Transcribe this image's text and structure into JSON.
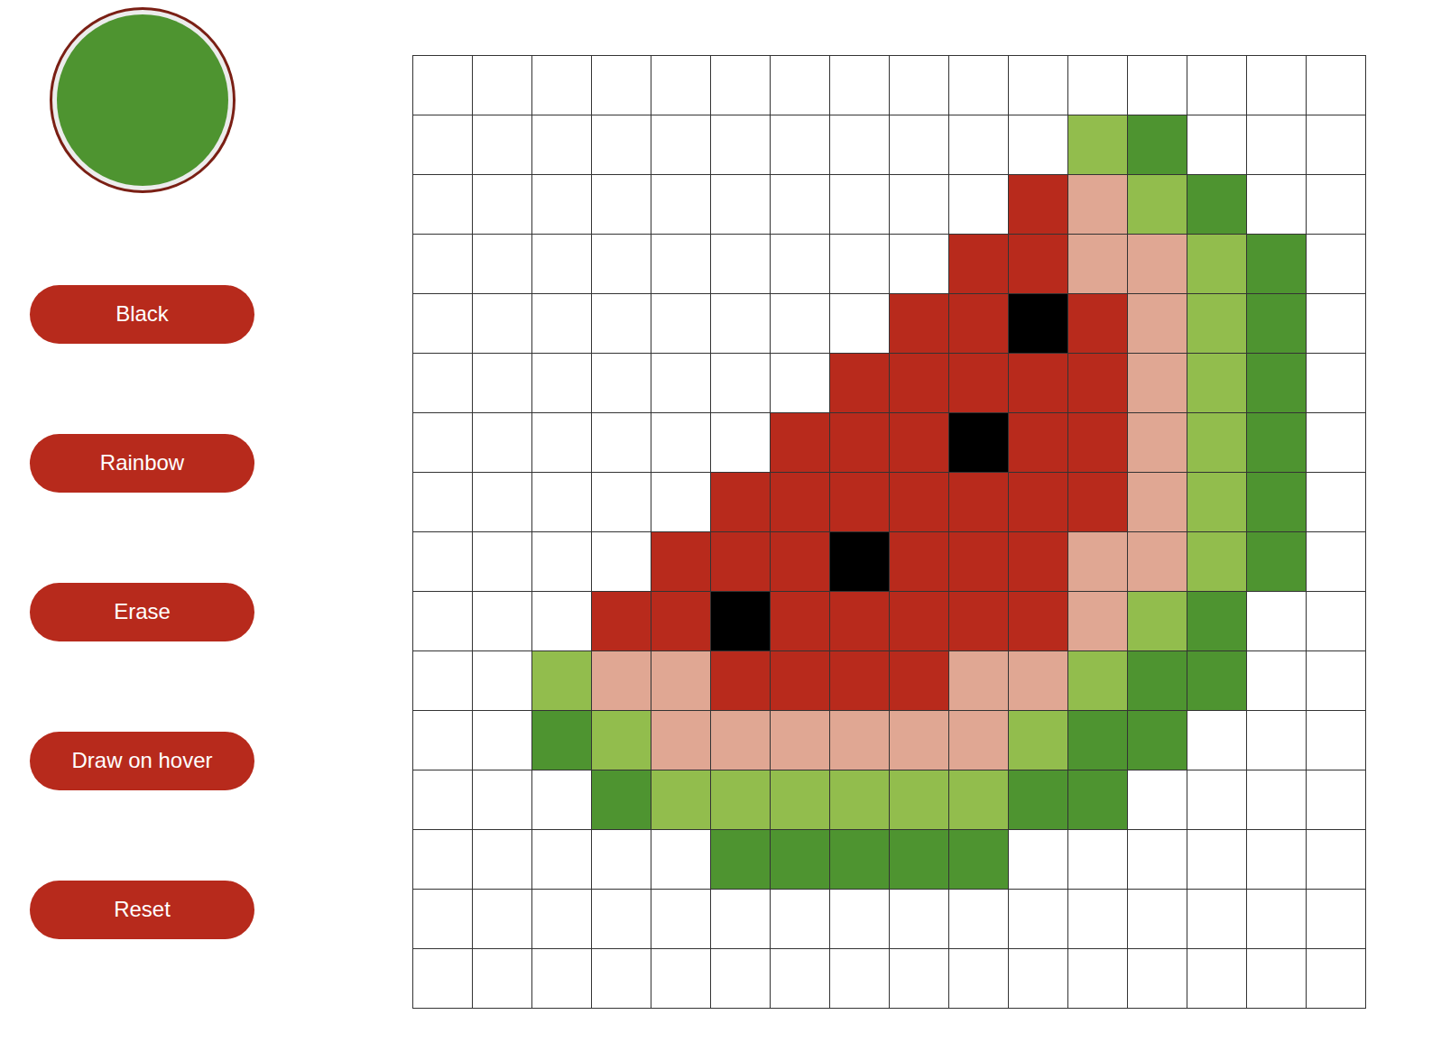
{
  "current_color": "#4e9430",
  "buttons": [
    "Black",
    "Rainbow",
    "Erase",
    "Draw on hover",
    "Reset"
  ],
  "grid": {
    "rows": [
      [
        "#ffffff",
        "#ffffff",
        "#ffffff",
        "#ffffff",
        "#ffffff",
        "#ffffff",
        "#ffffff",
        "#ffffff",
        "#ffffff",
        "#ffffff",
        "#ffffff",
        "#ffffff",
        "#ffffff",
        "#ffffff",
        "#ffffff",
        "#ffffff"
      ],
      [
        "#ffffff",
        "#ffffff",
        "#ffffff",
        "#ffffff",
        "#ffffff",
        "#ffffff",
        "#ffffff",
        "#ffffff",
        "#ffffff",
        "#ffffff",
        "#ffffff",
        "#92bd4d",
        "#4e9430",
        "#ffffff",
        "#ffffff",
        "#ffffff"
      ],
      [
        "#ffffff",
        "#ffffff",
        "#ffffff",
        "#ffffff",
        "#ffffff",
        "#ffffff",
        "#ffffff",
        "#ffffff",
        "#ffffff",
        "#ffffff",
        "#b82a1c",
        "#e0a793",
        "#92bd4d",
        "#4e9430",
        "#ffffff",
        "#ffffff"
      ],
      [
        "#ffffff",
        "#ffffff",
        "#ffffff",
        "#ffffff",
        "#ffffff",
        "#ffffff",
        "#ffffff",
        "#ffffff",
        "#ffffff",
        "#b82a1c",
        "#b82a1c",
        "#e0a793",
        "#e0a793",
        "#92bd4d",
        "#4e9430",
        "#ffffff"
      ],
      [
        "#ffffff",
        "#ffffff",
        "#ffffff",
        "#ffffff",
        "#ffffff",
        "#ffffff",
        "#ffffff",
        "#ffffff",
        "#b82a1c",
        "#b82a1c",
        "#000000",
        "#b82a1c",
        "#e0a793",
        "#92bd4d",
        "#4e9430",
        "#ffffff"
      ],
      [
        "#ffffff",
        "#ffffff",
        "#ffffff",
        "#ffffff",
        "#ffffff",
        "#ffffff",
        "#ffffff",
        "#b82a1c",
        "#b82a1c",
        "#b82a1c",
        "#b82a1c",
        "#b82a1c",
        "#e0a793",
        "#92bd4d",
        "#4e9430",
        "#ffffff"
      ],
      [
        "#ffffff",
        "#ffffff",
        "#ffffff",
        "#ffffff",
        "#ffffff",
        "#ffffff",
        "#b82a1c",
        "#b82a1c",
        "#b82a1c",
        "#000000",
        "#b82a1c",
        "#b82a1c",
        "#e0a793",
        "#92bd4d",
        "#4e9430",
        "#ffffff"
      ],
      [
        "#ffffff",
        "#ffffff",
        "#ffffff",
        "#ffffff",
        "#ffffff",
        "#b82a1c",
        "#b82a1c",
        "#b82a1c",
        "#b82a1c",
        "#b82a1c",
        "#b82a1c",
        "#b82a1c",
        "#e0a793",
        "#92bd4d",
        "#4e9430",
        "#ffffff"
      ],
      [
        "#ffffff",
        "#ffffff",
        "#ffffff",
        "#ffffff",
        "#b82a1c",
        "#b82a1c",
        "#b82a1c",
        "#000000",
        "#b82a1c",
        "#b82a1c",
        "#b82a1c",
        "#e0a793",
        "#e0a793",
        "#92bd4d",
        "#4e9430",
        "#ffffff"
      ],
      [
        "#ffffff",
        "#ffffff",
        "#ffffff",
        "#b82a1c",
        "#b82a1c",
        "#000000",
        "#b82a1c",
        "#b82a1c",
        "#b82a1c",
        "#b82a1c",
        "#b82a1c",
        "#e0a793",
        "#92bd4d",
        "#4e9430",
        "#ffffff",
        "#ffffff"
      ],
      [
        "#ffffff",
        "#ffffff",
        "#92bd4d",
        "#e0a793",
        "#e0a793",
        "#b82a1c",
        "#b82a1c",
        "#b82a1c",
        "#b82a1c",
        "#e0a793",
        "#e0a793",
        "#92bd4d",
        "#4e9430",
        "#4e9430",
        "#ffffff",
        "#ffffff"
      ],
      [
        "#ffffff",
        "#ffffff",
        "#4e9430",
        "#92bd4d",
        "#e0a793",
        "#e0a793",
        "#e0a793",
        "#e0a793",
        "#e0a793",
        "#e0a793",
        "#92bd4d",
        "#4e9430",
        "#4e9430",
        "#ffffff",
        "#ffffff",
        "#ffffff"
      ],
      [
        "#ffffff",
        "#ffffff",
        "#ffffff",
        "#4e9430",
        "#92bd4d",
        "#92bd4d",
        "#92bd4d",
        "#92bd4d",
        "#92bd4d",
        "#92bd4d",
        "#4e9430",
        "#4e9430",
        "#ffffff",
        "#ffffff",
        "#ffffff",
        "#ffffff"
      ],
      [
        "#ffffff",
        "#ffffff",
        "#ffffff",
        "#ffffff",
        "#ffffff",
        "#4e9430",
        "#4e9430",
        "#4e9430",
        "#4e9430",
        "#4e9430",
        "#ffffff",
        "#ffffff",
        "#ffffff",
        "#ffffff",
        "#ffffff",
        "#ffffff"
      ],
      [
        "#ffffff",
        "#ffffff",
        "#ffffff",
        "#ffffff",
        "#ffffff",
        "#ffffff",
        "#ffffff",
        "#ffffff",
        "#ffffff",
        "#ffffff",
        "#ffffff",
        "#ffffff",
        "#ffffff",
        "#ffffff",
        "#ffffff",
        "#ffffff"
      ],
      [
        "#ffffff",
        "#ffffff",
        "#ffffff",
        "#ffffff",
        "#ffffff",
        "#ffffff",
        "#ffffff",
        "#ffffff",
        "#ffffff",
        "#ffffff",
        "#ffffff",
        "#ffffff",
        "#ffffff",
        "#ffffff",
        "#ffffff",
        "#ffffff"
      ]
    ]
  }
}
